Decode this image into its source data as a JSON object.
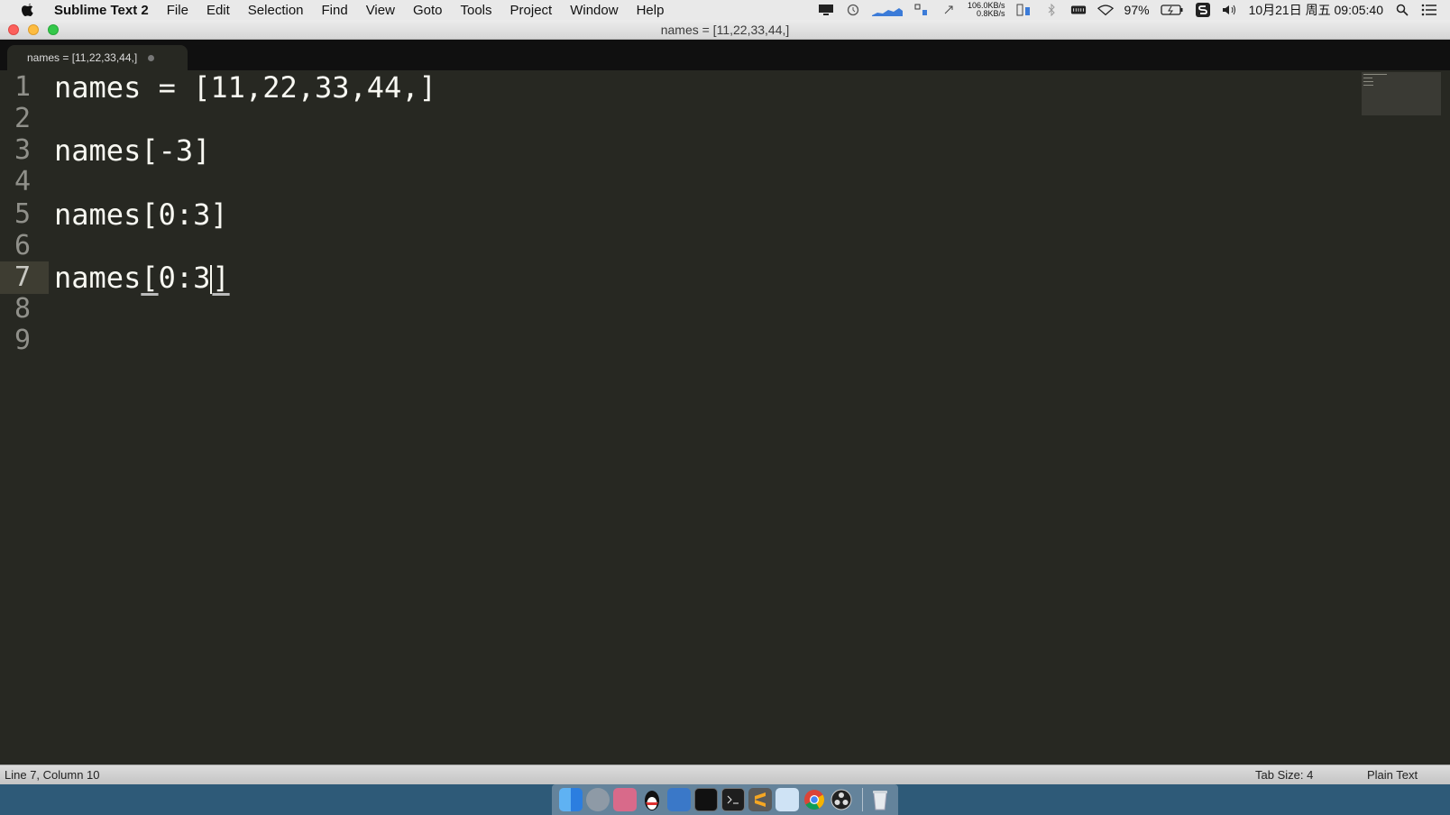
{
  "menubar": {
    "app_name": "Sublime Text 2",
    "menus": [
      "File",
      "Edit",
      "Selection",
      "Find",
      "View",
      "Goto",
      "Tools",
      "Project",
      "Window",
      "Help"
    ],
    "net_up": "106.0KB/s",
    "net_down": "0.8KB/s",
    "battery": "97%",
    "clock": "10月21日 周五 09:05:40"
  },
  "window": {
    "title": "names = [11,22,33,44,]"
  },
  "tab": {
    "label": "names = [11,22,33,44,]"
  },
  "editor": {
    "line_numbers": [
      "1",
      "2",
      "3",
      "4",
      "5",
      "6",
      "7",
      "8",
      "9"
    ],
    "lines": [
      "names = [11,22,33,44,]",
      "",
      "names[-3]",
      "",
      "names[0:3]",
      "",
      "names",
      "",
      ""
    ],
    "active_line": {
      "open_bracket": "[",
      "inner": "0:3",
      "close_bracket": "]"
    }
  },
  "statusbar": {
    "position": "Line 7, Column 10",
    "tab_size": "Tab Size: 4",
    "syntax": "Plain Text"
  },
  "colors": {
    "editor_bg": "#272822",
    "text": "#f8f8f2",
    "line_number": "#90908a"
  }
}
